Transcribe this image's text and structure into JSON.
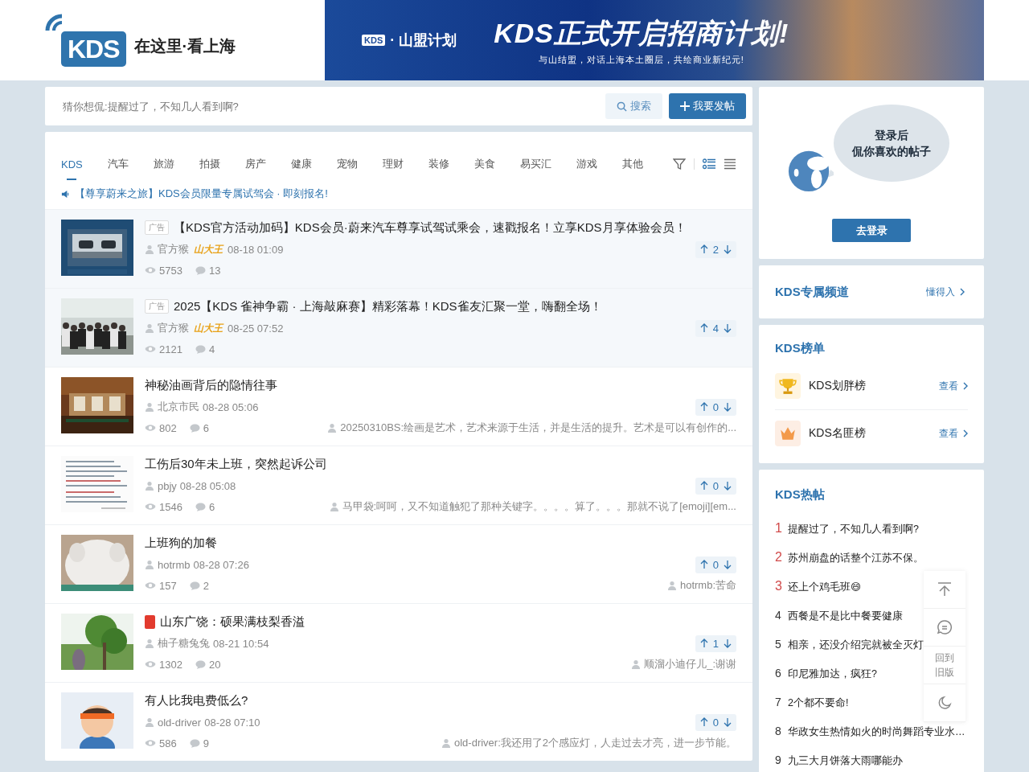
{
  "header": {
    "logo_text": "KDS",
    "slogan": "在这里·看上海"
  },
  "banner": {
    "logo_text": "KDS",
    "plan": "· 山盟计划",
    "title": "KDS正式开启招商计划!",
    "subtitle": "与山结盟，对话上海本土圈层，共绘商业新纪元!"
  },
  "search": {
    "placeholder": "猜你想侃:提醒过了，不知几人看到啊?",
    "search_button": "搜索",
    "post_button": "我要发帖"
  },
  "tabs": [
    {
      "label": "KDS",
      "selected": true
    },
    {
      "label": "汽车",
      "selected": false
    },
    {
      "label": "旅游",
      "selected": false
    },
    {
      "label": "拍摄",
      "selected": false
    },
    {
      "label": "房产",
      "selected": false
    },
    {
      "label": "健康",
      "selected": false
    },
    {
      "label": "宠物",
      "selected": false
    },
    {
      "label": "理财",
      "selected": false
    },
    {
      "label": "装修",
      "selected": false
    },
    {
      "label": "美食",
      "selected": false
    },
    {
      "label": "易买汇",
      "selected": false
    },
    {
      "label": "游戏",
      "selected": false
    },
    {
      "label": "其他",
      "selected": false
    }
  ],
  "view_modes": [
    {
      "kind": "detailed",
      "selected": true
    },
    {
      "kind": "compact",
      "selected": false
    }
  ],
  "notice": "【尊享蔚来之旅】KDS会员限量专属试驾会 · 即刻报名!",
  "posts": [
    {
      "badge": "广告",
      "title": "【KDS官方活动加码】KDS会员·蔚来汽车尊享试驾试乘会，速戳报名！立享KDS月享体验会员！",
      "author": "官方猴",
      "rank_badge": "山大王",
      "time": "08-18 01:09",
      "views": "5753",
      "comments": "13",
      "votes": "2"
    },
    {
      "badge": "广告",
      "title": "2025【KDS 雀神争霸 · 上海敲麻赛】精彩落幕！KDS雀友汇聚一堂，嗨翻全场！",
      "author": "官方猴",
      "rank_badge": "山大王",
      "time": "08-25 07:52",
      "views": "2121",
      "comments": "4",
      "votes": "4"
    },
    {
      "title": "神秘油画背后的隐情往事",
      "author": "北京市民",
      "time": "08-28 05:06",
      "views": "802",
      "comments": "6",
      "votes": "0",
      "last_reply": "20250310BS:绘画是艺术，艺术来源于生活，并是生活的提升。艺术是可以有创作的..."
    },
    {
      "title": "工伤后30年未上班，突然起诉公司",
      "author": "pbjy",
      "time": "08-28 05:08",
      "views": "1546",
      "comments": "6",
      "votes": "0",
      "last_reply": "马甲袋:呵呵，又不知道触犯了那种关键字。。。。算了。。。那就不说了[emoji][em..."
    },
    {
      "title": "上班狗的加餐",
      "author": "hotrmb",
      "time": "08-28 07:26",
      "views": "157",
      "comments": "2",
      "votes": "0",
      "last_reply": "hotrmb:苦命"
    },
    {
      "red_packet": true,
      "title": "山东广饶：硕果满枝梨香溢",
      "author": "柚子糖兔兔",
      "time": "08-21 10:54",
      "views": "1302",
      "comments": "20",
      "votes": "1",
      "last_reply": "顺溜小迪仔儿_:谢谢"
    },
    {
      "title": "有人比我电费低么?",
      "author": "old-driver",
      "time": "08-28 07:10",
      "views": "586",
      "comments": "9",
      "votes": "0",
      "last_reply": "old-driver:我还用了2个感应灯，人走过去才亮，进一步节能。"
    }
  ],
  "login_card": {
    "lines": [
      "登录后",
      "侃你喜欢的帖子"
    ],
    "button": "去登录"
  },
  "channel_card": {
    "title": "KDS专属频道",
    "link": "懂得入"
  },
  "ranks_card": {
    "title": "KDS榜单",
    "items": [
      {
        "kind": "trophy",
        "name": "KDS划胖榜",
        "link": "查看"
      },
      {
        "kind": "crown",
        "name": "KDS名匪榜",
        "link": "查看"
      }
    ]
  },
  "hot_card": {
    "title": "KDS热帖",
    "items": [
      {
        "rank": "1",
        "top": true,
        "text": "提醒过了，不知几人看到啊?"
      },
      {
        "rank": "2",
        "top": true,
        "text": "苏州崩盘的话整个江苏不保。"
      },
      {
        "rank": "3",
        "top": true,
        "text": "还上个鸡毛班😄"
      },
      {
        "rank": "4",
        "top": false,
        "text": "西餐是不是比中餐要健康"
      },
      {
        "rank": "5",
        "top": false,
        "text": "相亲，还没介绍完就被全灭灯"
      },
      {
        "rank": "6",
        "top": false,
        "text": "印尼雅加达，疯狂?"
      },
      {
        "rank": "7",
        "top": false,
        "text": "2个都不要命!"
      },
      {
        "rank": "8",
        "top": false,
        "text": "华政女生热情如火的时尚舞蹈专业水…"
      },
      {
        "rank": "9",
        "top": false,
        "text": "九三大月饼落大雨哪能办"
      }
    ]
  },
  "float_bar": [
    {
      "kind": "top"
    },
    {
      "kind": "chat"
    },
    {
      "kind": "text",
      "label": "回到旧版"
    },
    {
      "kind": "night"
    }
  ]
}
